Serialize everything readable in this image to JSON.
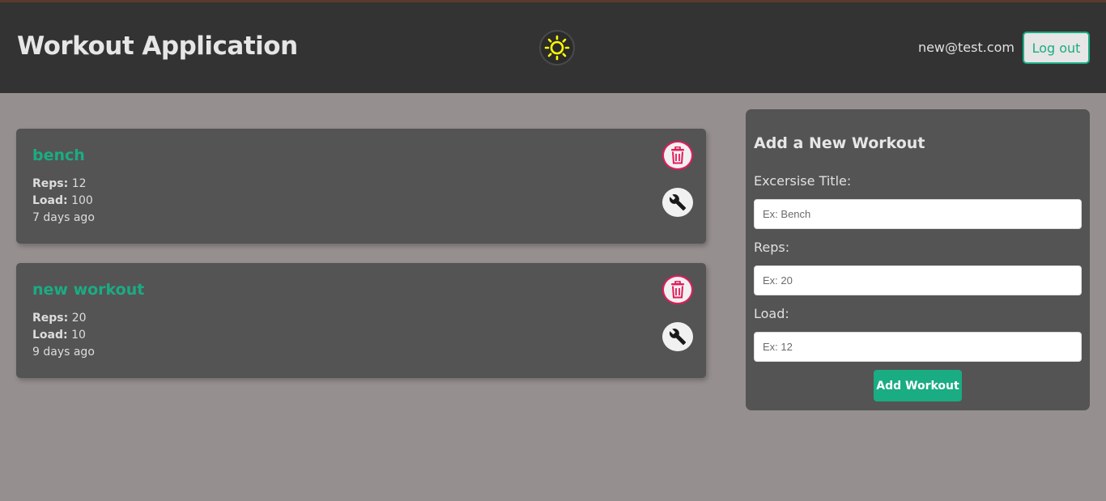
{
  "header": {
    "title": "Workout Application",
    "user_email": "new@test.com",
    "logout_label": "Log out",
    "theme_icon": "sun-icon"
  },
  "workouts": [
    {
      "title": "bench",
      "reps_label": "Reps:",
      "reps": "12",
      "load_label": "Load:",
      "load": "100",
      "time": "7 days ago"
    },
    {
      "title": "new workout",
      "reps_label": "Reps:",
      "reps": "20",
      "load_label": "Load:",
      "load": "10",
      "time": "9 days ago"
    }
  ],
  "form": {
    "heading": "Add a New Workout",
    "title_label": "Excersise Title:",
    "title_placeholder": "Ex: Bench",
    "reps_label": "Reps:",
    "reps_placeholder": "Ex: 20",
    "load_label": "Load:",
    "load_placeholder": "Ex: 12",
    "submit_label": "Add Workout"
  },
  "colors": {
    "accent": "#1aac83",
    "danger": "#e7195a",
    "header_bg": "#333333",
    "page_bg": "#968f8f",
    "card_bg": "#545454",
    "sun": "#ffff00"
  }
}
